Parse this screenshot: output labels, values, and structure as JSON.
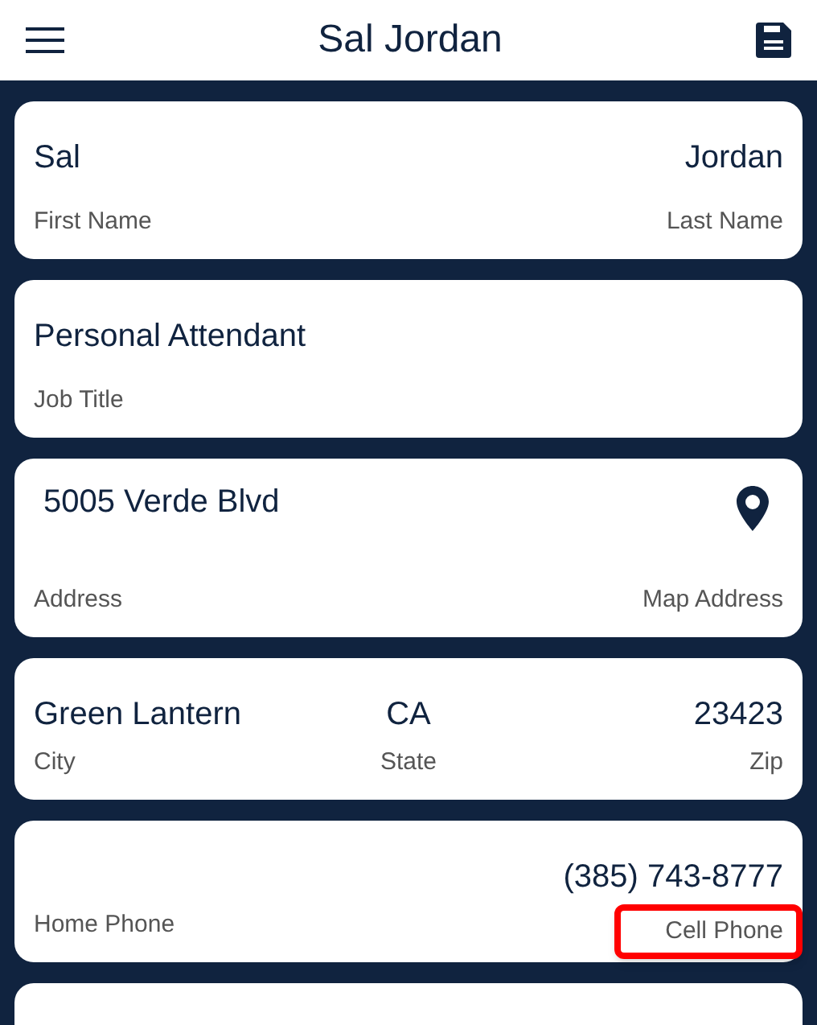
{
  "header": {
    "title": "Sal Jordan"
  },
  "cards": [
    {
      "columns": [
        {
          "kind": "text",
          "value": "Sal",
          "label": "First Name",
          "highlighted": false
        },
        {
          "kind": "text",
          "value": "Jordan",
          "label": "Last Name",
          "highlighted": false
        }
      ]
    },
    {
      "columns": [
        {
          "kind": "text",
          "value": "Personal Attendant",
          "label": "Job Title",
          "highlighted": false
        }
      ]
    },
    {
      "columns": [
        {
          "kind": "text",
          "value": "5005 Verde Blvd",
          "label": "Address",
          "highlighted": false
        },
        {
          "kind": "map",
          "label": "Map Address",
          "highlighted": false
        }
      ]
    },
    {
      "columns": [
        {
          "kind": "text",
          "value": "Green Lantern",
          "label": "City",
          "highlighted": false
        },
        {
          "kind": "text",
          "value": "CA",
          "label": "State",
          "highlighted": false
        },
        {
          "kind": "text",
          "value": "23423",
          "label": "Zip",
          "highlighted": false
        }
      ]
    },
    {
      "columns": [
        {
          "kind": "text",
          "label": "Home Phone",
          "highlighted": false
        },
        {
          "kind": "text",
          "value": "(385) 743-8777",
          "label": "Cell Phone",
          "highlighted": true
        }
      ]
    }
  ]
}
